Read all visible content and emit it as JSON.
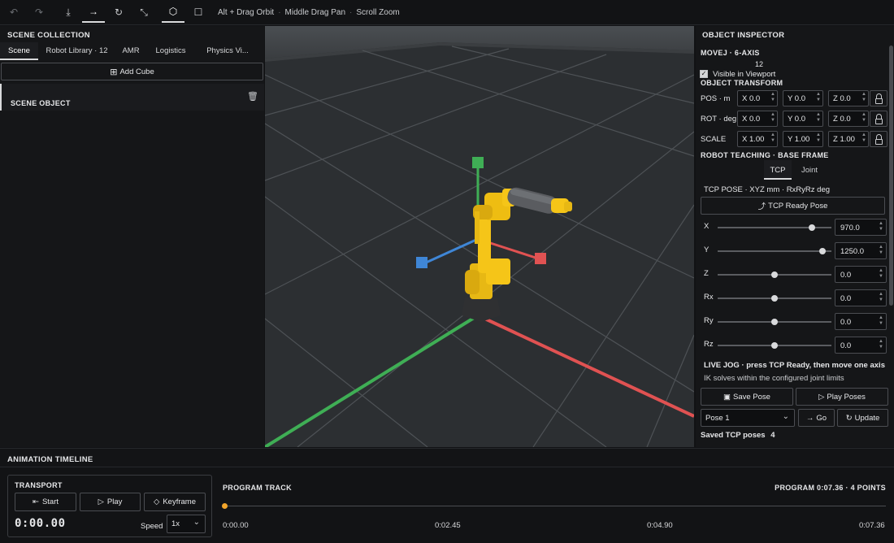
{
  "toolbar": {
    "buttons": [
      "undo-icon",
      "redo-icon",
      "download-icon",
      "translate-icon",
      "rotate-icon",
      "scale-icon",
      "cube-icon",
      "square-icon"
    ],
    "hint1": "Alt + Drag Orbit",
    "hint2": "Middle Drag Pan",
    "hint3": "Scroll Zoom",
    "sep": "·"
  },
  "scene_collection": {
    "title": "SCENE COLLECTION",
    "tabs": [
      {
        "label": "Scene",
        "active": true
      },
      {
        "label": "Robot Library · 12",
        "active": false
      },
      {
        "label": "AMR",
        "active": false
      },
      {
        "label": "Logistics",
        "active": false
      },
      {
        "label": "Physics  Vi...",
        "active": false
      }
    ],
    "add_button": "Add Cube",
    "add_icon": "⊞",
    "object_label": "SCENE OBJECT",
    "trash_icon": "🗑"
  },
  "inspector": {
    "title": "OBJECT INSPECTOR",
    "object_name": "MOVEJ · 6-AXIS",
    "object_count": "12",
    "visible_label": "Visible in Viewport",
    "visible_checked": true,
    "transform_title": "OBJECT TRANSFORM",
    "rows": [
      {
        "label": "POS · m",
        "x": "X 0.0",
        "y": "Y 0.0",
        "z": "Z 0.0"
      },
      {
        "label": "ROT · deg",
        "x": "X 0.0",
        "y": "Y 0.0",
        "z": "Z 0.0"
      },
      {
        "label": "SCALE",
        "x": "X 1.00",
        "y": "Y 1.00",
        "z": "Z 1.00"
      }
    ],
    "teaching_title": "ROBOT TEACHING · BASE FRAME",
    "mode_tabs": [
      {
        "label": "TCP",
        "active": true
      },
      {
        "label": "Joint",
        "active": false
      }
    ],
    "tcp_pose_title": "TCP POSE · XYZ mm · RxRyRz deg",
    "ready_button": "TCP Ready Pose",
    "ready_icon": "⤴",
    "axes": [
      {
        "label": "X",
        "value": "970.0",
        "fraction": 0.83
      },
      {
        "label": "Y",
        "value": "1250.0",
        "fraction": 0.92
      },
      {
        "label": "Z",
        "value": "0.0",
        "fraction": 0.5
      },
      {
        "label": "Rx",
        "value": "0.0",
        "fraction": 0.5
      },
      {
        "label": "Ry",
        "value": "0.0",
        "fraction": 0.5
      },
      {
        "label": "Rz",
        "value": "0.0",
        "fraction": 0.5
      }
    ],
    "live_jog_note": "LIVE JOG · press TCP Ready, then move one axis",
    "ik_note": "IK solves within the configured joint limits",
    "save_pose": "Save Pose",
    "play_poses": "Play Poses",
    "pose_select": "Pose 1",
    "go_button": "Go",
    "update_button": "Update",
    "saved_label": "Saved TCP poses",
    "saved_count": "4"
  },
  "timeline": {
    "title": "ANIMATION TIMELINE",
    "transport_title": "TRANSPORT",
    "start": "Start",
    "play": "Play",
    "keyframe": "Keyframe",
    "timecode": "0:00.00",
    "speed_label": "Speed",
    "speed_value": "1x",
    "track_title": "PROGRAM TRACK",
    "program_info": "PROGRAM  0:07.36 · 4 POINTS",
    "ticks": [
      "0:00.00",
      "0:02.45",
      "0:04.90",
      "0:07.36"
    ]
  },
  "colors": {
    "accent": "#f2a52b",
    "robot": "#f5c518",
    "axis_x": "#e05252",
    "axis_y": "#3fae55",
    "axis_z": "#3f86d6"
  }
}
